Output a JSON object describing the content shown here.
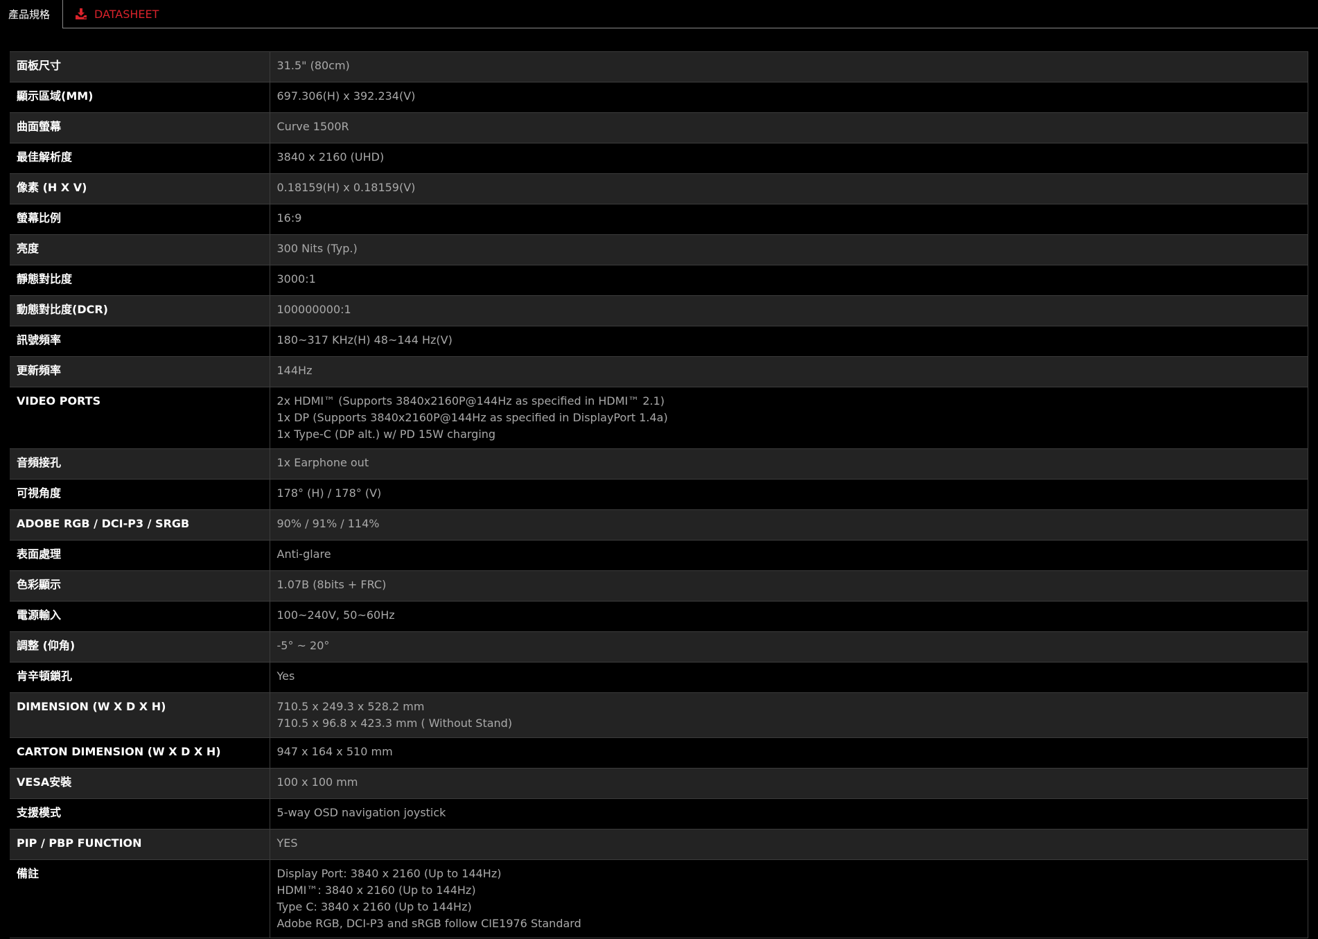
{
  "tabs": [
    {
      "label": "產品規格"
    },
    {
      "label": "DATASHEET",
      "icon": "download-icon",
      "color": "#d9232b"
    }
  ],
  "specs": [
    {
      "label": "面板尺寸",
      "value": [
        "31.5\" (80cm)"
      ]
    },
    {
      "label": "顯示區域(MM)",
      "value": [
        "697.306(H) x 392.234(V)"
      ]
    },
    {
      "label": "曲面螢幕",
      "value": [
        "Curve 1500R"
      ]
    },
    {
      "label": "最佳解析度",
      "value": [
        "3840 x 2160 (UHD)"
      ]
    },
    {
      "label": "像素 (H X V)",
      "value": [
        "0.18159(H) x 0.18159(V)"
      ]
    },
    {
      "label": "螢幕比例",
      "value": [
        "16:9"
      ]
    },
    {
      "label": "亮度",
      "value": [
        "300 Nits (Typ.)"
      ]
    },
    {
      "label": "靜態對比度",
      "value": [
        "3000:1"
      ]
    },
    {
      "label": "動態對比度(DCR)",
      "value": [
        "100000000:1"
      ]
    },
    {
      "label": "訊號頻率",
      "value": [
        "180~317 KHz(H) 48~144 Hz(V)"
      ]
    },
    {
      "label": "更新頻率",
      "value": [
        "144Hz"
      ]
    },
    {
      "label": "VIDEO PORTS",
      "value": [
        "2x HDMI™ (Supports 3840x2160P@144Hz as specified in HDMI™ 2.1)",
        "1x DP (Supports 3840x2160P@144Hz as specified in DisplayPort 1.4a)",
        "1x Type-C (DP alt.) w/ PD 15W charging"
      ]
    },
    {
      "label": "音頻接孔",
      "value": [
        "1x Earphone out"
      ]
    },
    {
      "label": "可視角度",
      "value": [
        "178° (H) / 178° (V)"
      ]
    },
    {
      "label": "ADOBE RGB / DCI-P3 / SRGB",
      "value": [
        "90% / 91% / 114%"
      ]
    },
    {
      "label": "表面處理",
      "value": [
        "Anti-glare"
      ]
    },
    {
      "label": "色彩顯示",
      "value": [
        "1.07B (8bits + FRC)"
      ]
    },
    {
      "label": "電源輸入",
      "value": [
        "100~240V, 50~60Hz"
      ]
    },
    {
      "label": "調整 (仰角)",
      "value": [
        "-5° ~ 20°"
      ]
    },
    {
      "label": "肯辛頓鎖孔",
      "value": [
        "Yes"
      ]
    },
    {
      "label": "DIMENSION (W X D X H)",
      "value": [
        "710.5 x 249.3 x 528.2 mm",
        "710.5 x 96.8 x 423.3 mm ( Without Stand)"
      ]
    },
    {
      "label": "CARTON DIMENSION (W X D X H)",
      "value": [
        "947 x 164 x 510 mm"
      ]
    },
    {
      "label": "VESA安裝",
      "value": [
        "100 x 100 mm"
      ]
    },
    {
      "label": "支援模式",
      "value": [
        "5-way OSD navigation joystick"
      ]
    },
    {
      "label": "PIP / PBP FUNCTION",
      "value": [
        "YES"
      ]
    },
    {
      "label": "備註",
      "value": [
        "Display Port: 3840 x 2160 (Up to 144Hz)",
        "HDMI™: 3840 x 2160 (Up to 144Hz)",
        "Type C: 3840 x 2160 (Up to 144Hz)",
        "Adobe RGB, DCI-P3 and sRGB follow CIE1976 Standard"
      ]
    }
  ]
}
